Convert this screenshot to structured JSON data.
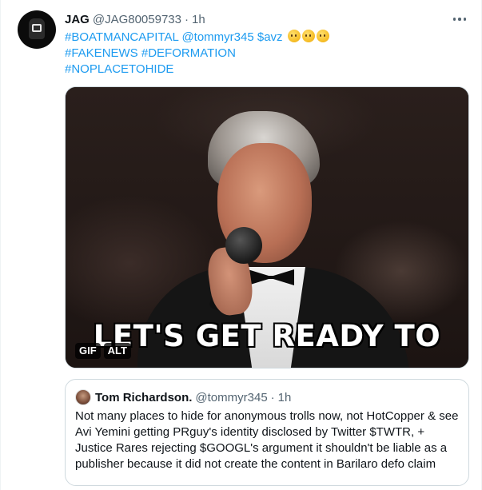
{
  "tweet": {
    "author_name": "JAG",
    "author_handle": "@JAG80059733",
    "separator": "·",
    "time": "1h",
    "text_line1_tag": "#BOATMANCAPITAL",
    "text_line1_mention": "@tommyr345",
    "text_line1_cashtag": "$avz",
    "text_line2_tag1": "#FAKENEWS",
    "text_line2_tag2": "#DEFORMATION",
    "text_line3_tag": "#NOPLACETOHIDE",
    "emoji": "thinking-face",
    "emoji_count": 3
  },
  "media": {
    "caption": "LET'S GET READY TO",
    "gif_badge": "GIF",
    "alt_badge": "ALT"
  },
  "quote": {
    "author_name": "Tom Richardson.",
    "author_handle": "@tommyr345",
    "separator": "·",
    "time": "1h",
    "text": "Not many places to hide for anonymous trolls now, not HotCopper & see Avi Yemini getting PRguy's identity disclosed by Twitter $TWTR, + Justice Rares rejecting $GOOGL's argument it shouldn't be liable as a publisher because it did not create the content in Barilaro defo claim"
  },
  "colors": {
    "link": "#1d9bf0",
    "secondary_text": "#536471",
    "primary_text": "#0f1419",
    "border": "#cfd9de"
  }
}
